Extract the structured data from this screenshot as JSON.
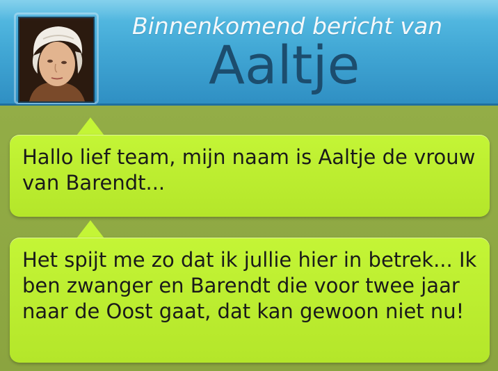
{
  "header": {
    "title": "Binnenkomend bericht van",
    "sender": "Aaltje"
  },
  "messages": [
    {
      "text": "Hallo lief team, mijn naam is Aaltje de vrouw van Barendt..."
    },
    {
      "text": "Het spijt me zo dat ik jullie hier in betrek... Ik ben zwanger en Barendt die voor twee jaar naar de Oost gaat, dat kan gewoon niet nu!"
    }
  ],
  "colors": {
    "header_blue": "#43a9d6",
    "name_dark_blue": "#1c4d6e",
    "bubble_green": "#c4f536",
    "background_olive": "#8fa844"
  },
  "icons": {
    "avatar": "portrait-woman-bonnet"
  }
}
